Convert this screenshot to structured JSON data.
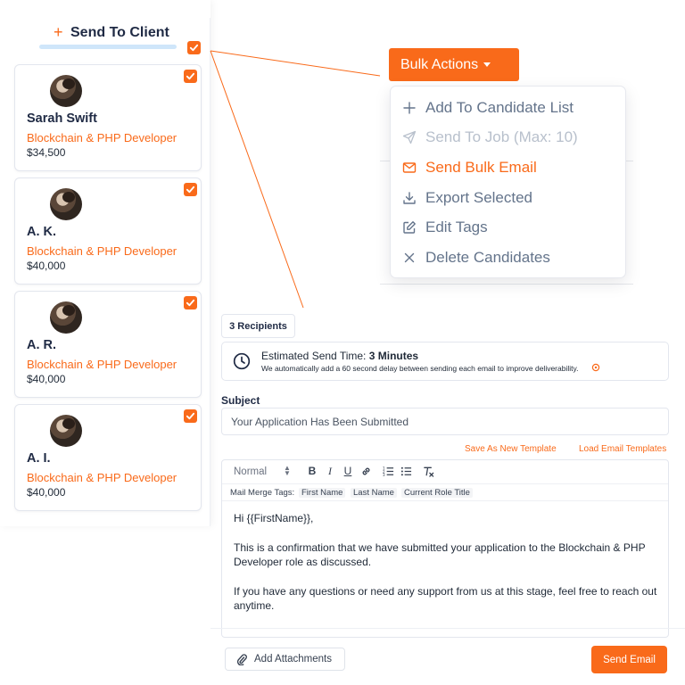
{
  "colors": {
    "accent": "#f96a1a",
    "text": "#1f2a44",
    "muted": "#64748b"
  },
  "sidebar": {
    "send_to_client_icon": "+",
    "send_to_client_label": "Send To Client",
    "select_all_checked": true,
    "candidates": [
      {
        "name": "Sarah Swift",
        "role": "Blockchain & PHP Developer",
        "salary": "$34,500",
        "checked": true
      },
      {
        "name": "A. K.",
        "role": "Blockchain & PHP Developer",
        "salary": "$40,000",
        "checked": true
      },
      {
        "name": "A. R.",
        "role": "Blockchain & PHP Developer",
        "salary": "$40,000",
        "checked": true
      },
      {
        "name": "A. I.",
        "role": "Blockchain & PHP Developer",
        "salary": "$40,000",
        "checked": true
      }
    ]
  },
  "bulk_actions": {
    "label": "Bulk Actions",
    "menu": [
      {
        "icon": "plus-icon",
        "label": "Add To Candidate List",
        "state": "normal"
      },
      {
        "icon": "send-icon",
        "label": "Send To Job (Max: 10)",
        "state": "disabled"
      },
      {
        "icon": "mail-icon",
        "label": "Send Bulk Email",
        "state": "active"
      },
      {
        "icon": "download-icon",
        "label": "Export Selected",
        "state": "normal"
      },
      {
        "icon": "edit-icon",
        "label": "Edit Tags",
        "state": "normal"
      },
      {
        "icon": "close-icon",
        "label": "Delete Candidates",
        "state": "normal"
      }
    ]
  },
  "email": {
    "recipients": "3 Recipients",
    "estimate_label": "Estimated Send Time:",
    "estimate_value": "3 Minutes",
    "estimate_note": "We automatically add a 60 second delay between sending each email to improve deliverability.",
    "subject_label": "Subject",
    "subject_value": "Your Application Has Been Submitted",
    "save_template": "Save As New Template",
    "load_templates": "Load Email Templates",
    "editor": {
      "format": "Normal",
      "merge_label": "Mail Merge Tags:",
      "merge_tags": [
        "First Name",
        "Last Name",
        "Current Role Title"
      ],
      "paragraphs": [
        "Hi {{FirstName}},",
        "This is a confirmation that we have submitted your application to the Blockchain & PHP Developer role as discussed.",
        "If you have any questions or need any support from us at this stage, feel free to reach out anytime."
      ]
    },
    "add_attachments": "Add Attachments",
    "send_email": "Send Email"
  }
}
